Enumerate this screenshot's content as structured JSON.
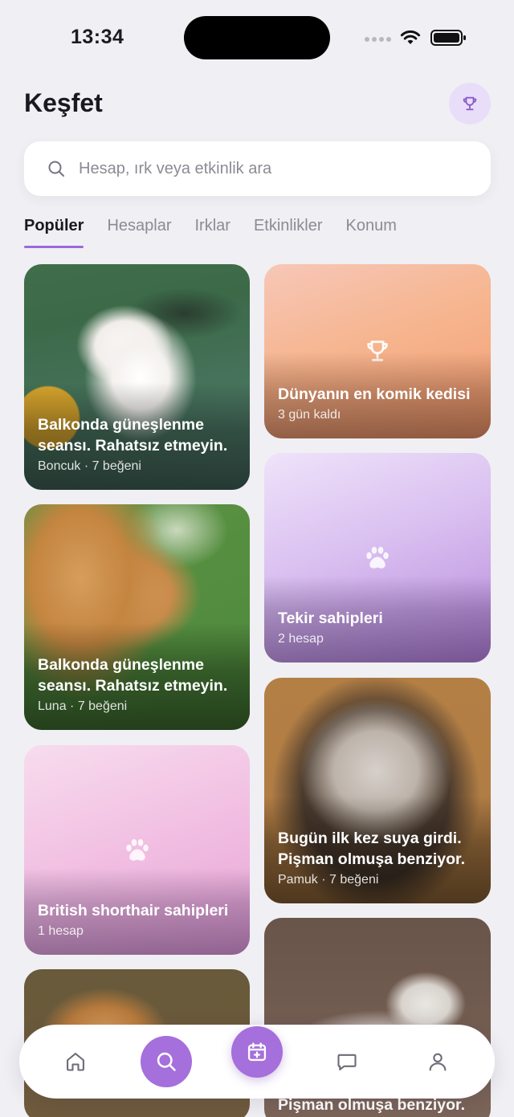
{
  "status_bar": {
    "time": "13:34"
  },
  "header": {
    "title": "Keşfet"
  },
  "search": {
    "placeholder": "Hesap, ırk veya etkinlik ara",
    "value": ""
  },
  "tabs": [
    {
      "label": "Popüler",
      "active": true
    },
    {
      "label": "Hesaplar",
      "active": false
    },
    {
      "label": "Irklar",
      "active": false
    },
    {
      "label": "Etkinlikler",
      "active": false
    },
    {
      "label": "Konum",
      "active": false
    }
  ],
  "cards": {
    "post_pomeranian": {
      "title": "Balkonda güneşlenme seansı. Rahatsız etmeyin.",
      "meta": "Boncuk · 7 beğeni"
    },
    "event_funny_cat": {
      "title": "Dünyanın en komik kedisi",
      "meta": "3 gün kaldı",
      "icon": "trophy-icon"
    },
    "breed_tekir": {
      "title": "Tekir sahipleri",
      "meta": "2 hesap",
      "icon": "paw-icon"
    },
    "post_golden": {
      "title": "Balkonda güneşlenme seansı. Rahatsız etmeyin.",
      "meta": "Luna · 7 beğeni"
    },
    "post_cat_pamuk": {
      "title": "Bugün ilk kez suya girdi. Pişman olmuşa benziyor.",
      "meta": "Pamuk · 7 beğeni"
    },
    "breed_british": {
      "title": "British shorthair sahipleri",
      "meta": "1 hesap",
      "icon": "paw-icon"
    },
    "post_cat_partial": {
      "title": "Pişman olmuşa benziyor."
    }
  },
  "bottom_nav": {
    "items": [
      {
        "name": "home",
        "icon": "home-icon"
      },
      {
        "name": "search",
        "icon": "search-icon",
        "active": true
      },
      {
        "name": "create",
        "icon": "calendar-plus-icon"
      },
      {
        "name": "messages",
        "icon": "chat-icon"
      },
      {
        "name": "profile",
        "icon": "user-icon"
      }
    ]
  },
  "colors": {
    "accent": "#a56fdc",
    "tab_underline": "#9b6ad8",
    "background": "#f0eff3"
  }
}
